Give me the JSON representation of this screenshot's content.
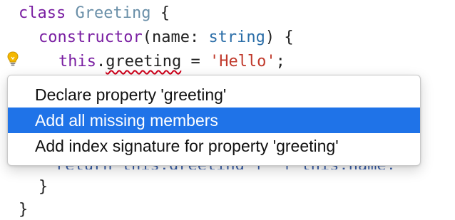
{
  "code": {
    "line1": {
      "class_kw": "class",
      "class_name": "Greeting",
      "brace": "{"
    },
    "line2": {
      "ctor": "constructor",
      "open": "(",
      "param": "name",
      "colon": ": ",
      "type": "string",
      "close": ") {"
    },
    "line3": {
      "this_kw": "this",
      "dot": ".",
      "prop": "greeting",
      "assign": " = ",
      "value": "'Hello'",
      "semi": ";"
    },
    "line_hidden": {
      "text_a": "return this.",
      "prop": "greeting",
      "text_b": " + ",
      "text_c": " + this.",
      "name": "name",
      "semi": ";"
    },
    "line_close_method": "}",
    "line_close_class": "}"
  },
  "lightbulb": {
    "icon": "lightbulb-icon",
    "color": "#f5b800"
  },
  "quick_fix_menu": {
    "items": [
      {
        "label": "Declare property 'greeting'",
        "selected": false
      },
      {
        "label": "Add all missing members",
        "selected": true
      },
      {
        "label": "Add index signature for property 'greeting'",
        "selected": false
      }
    ],
    "selection_color": "#1f73e8"
  },
  "colors": {
    "keyword": "#7a1fa2",
    "type": "#2b6ea8",
    "string": "#c0392b",
    "error_squiggle": "#d0021b"
  }
}
